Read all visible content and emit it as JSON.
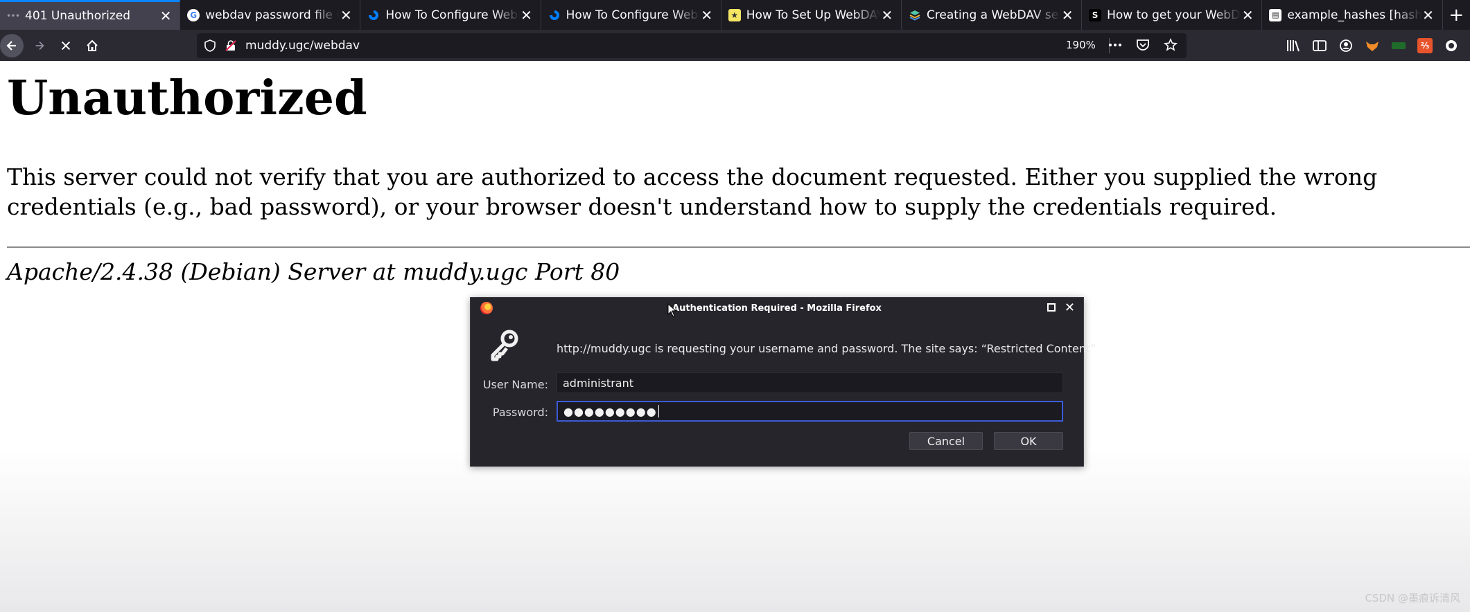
{
  "tabs": [
    {
      "title": "401 Unauthorized",
      "favicon": "loading-icon",
      "active": true
    },
    {
      "title": "webdav password file lo",
      "favicon": "google-icon",
      "active": false
    },
    {
      "title": "How To Configure WebD",
      "favicon": "digitalocean-icon",
      "active": false
    },
    {
      "title": "How To Configure WebD",
      "favicon": "digitalocean-icon",
      "active": false
    },
    {
      "title": "How To Set Up WebDAV",
      "favicon": "bookmark-icon",
      "active": false
    },
    {
      "title": "Creating a WebDAV serv",
      "favicon": "stack-icon",
      "active": false
    },
    {
      "title": "How to get your WebDA",
      "favicon": "s-icon",
      "active": false
    },
    {
      "title": "example_hashes [hashca",
      "favicon": "doc-icon",
      "active": false
    }
  ],
  "nav": {
    "url": "muddy.ugc/webdav",
    "zoom": "190%"
  },
  "page": {
    "heading": "Unauthorized",
    "message": "This server could not verify that you are authorized to access the document requested. Either you supplied the wrong credentials (e.g., bad password), or your browser doesn't understand how to supply the credentials required.",
    "address": "Apache/2.4.38 (Debian) Server at muddy.ugc Port 80"
  },
  "dialog": {
    "title": "Authentication Required - Mozilla Firefox",
    "message": "http://muddy.ugc is requesting your username and password. The site says: “Restricted Content”",
    "username_label": "User Name:",
    "username_value": "administrant",
    "password_label": "Password:",
    "password_value": "●●●●●●●●●",
    "cancel_label": "Cancel",
    "ok_label": "OK"
  },
  "watermark": "CSDN @墨痕诉清风",
  "colors": {
    "tabbar_bg": "#1c1b22",
    "navbar_bg": "#2b2a33",
    "active_tab_accent": "#0a84ff",
    "dialog_bg": "#26252c",
    "focus_border": "#3b5bd6"
  }
}
